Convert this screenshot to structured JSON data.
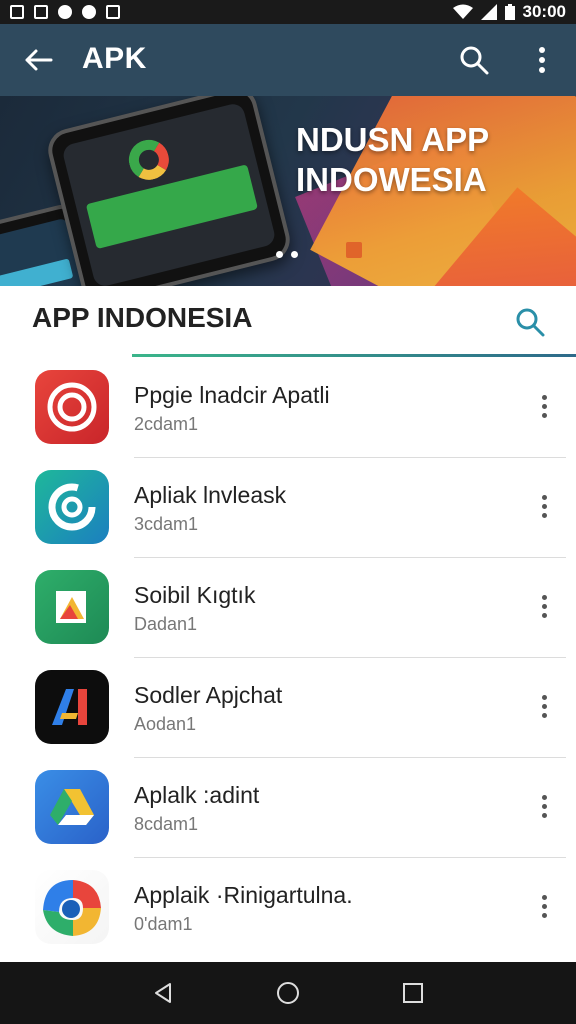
{
  "status_bar": {
    "time": "30:00",
    "left_icons": [
      "gallery-icon",
      "message-icon",
      "sync-icon",
      "circle-icon",
      "notification-icon"
    ],
    "right_icons": [
      "wifi-icon",
      "signal-icon",
      "battery-icon"
    ]
  },
  "app_bar": {
    "title": "APK",
    "back_icon": "arrow-left-icon",
    "search_icon": "search-icon",
    "more_icon": "more-vert-icon",
    "color": "#2f4a5e"
  },
  "banner": {
    "headline_line1": "NDUSN APP",
    "headline_line2": "INDOWESIA",
    "page_count": 2
  },
  "section": {
    "title": "APP INDONESIA",
    "search_icon": "search-icon",
    "accent": "#2a8fa8"
  },
  "apps": [
    {
      "name": "Ppgie lnadcir Apatli",
      "meta": "2cdam1",
      "icon": "target-icon"
    },
    {
      "name": "Apliak lnvleask",
      "meta": "3cdam1",
      "icon": "c-ring-icon"
    },
    {
      "name": "Soibil Kıgtık",
      "meta": "Dadan1",
      "icon": "folder-shapes-icon"
    },
    {
      "name": "Sodler Apjchat",
      "meta": "Aodan1",
      "icon": "ai-letter-icon"
    },
    {
      "name": "Aplalk :adint",
      "meta": "8cdam1",
      "icon": "drive-triangle-icon"
    },
    {
      "name": "Applaik ·Rinigartulna.",
      "meta": "0'dam1",
      "icon": "multicolor-swirl-icon"
    }
  ],
  "nav_bar": {
    "back_icon": "nav-back-icon",
    "home_icon": "nav-home-icon",
    "recents_icon": "nav-recents-icon"
  }
}
